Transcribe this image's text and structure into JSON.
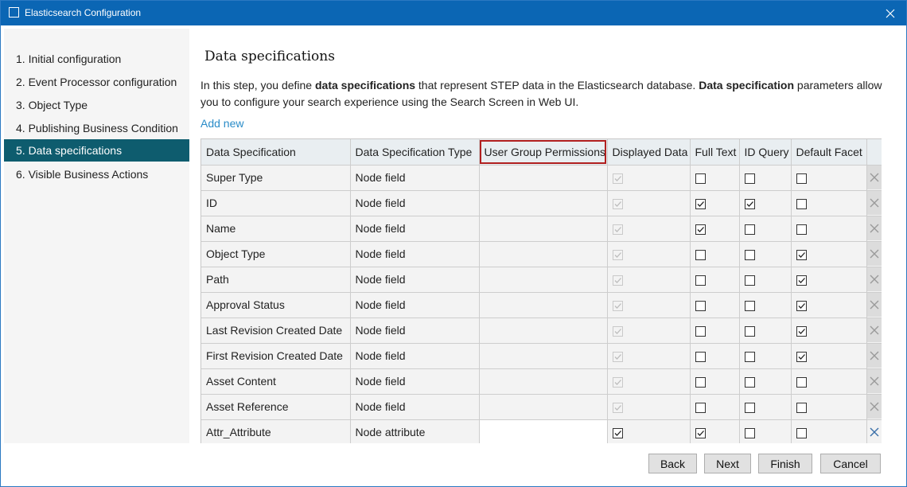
{
  "window": {
    "title": "Elasticsearch Configuration"
  },
  "steps": [
    {
      "label": "1. Initial configuration"
    },
    {
      "label": "2. Event Processor configuration"
    },
    {
      "label": "3. Object Type"
    },
    {
      "label": "4. Publishing Business Condition"
    },
    {
      "label": "5. Data specifications",
      "active": true
    },
    {
      "label": "6. Visible Business Actions"
    }
  ],
  "content": {
    "heading": "Data specifications",
    "desc": {
      "p1": "In this step, you define ",
      "b1": "data specifications",
      "p2": " that represent STEP data in the Elasticsearch database. ",
      "b2": "Data specification",
      "p3": " parameters allow you to configure your search experience using the Search Screen in Web UI."
    },
    "add_new": "Add new"
  },
  "table": {
    "columns": [
      "Data Specification",
      "Data Specification Type",
      "User Group Permissions",
      "Displayed Data",
      "Full Text",
      "ID Query",
      "Default Facet"
    ],
    "highlighted_column": "User Group Permissions",
    "rows": [
      {
        "spec": "Super Type",
        "type": "Node field",
        "perm": "",
        "displayed": true,
        "displayed_enabled": false,
        "full_text": false,
        "id_query": false,
        "facet": false
      },
      {
        "spec": "ID",
        "type": "Node field",
        "perm": "",
        "displayed": true,
        "displayed_enabled": false,
        "full_text": true,
        "id_query": true,
        "facet": false
      },
      {
        "spec": "Name",
        "type": "Node field",
        "perm": "",
        "displayed": true,
        "displayed_enabled": false,
        "full_text": true,
        "id_query": false,
        "facet": false
      },
      {
        "spec": "Object Type",
        "type": "Node field",
        "perm": "",
        "displayed": true,
        "displayed_enabled": false,
        "full_text": false,
        "id_query": false,
        "facet": true
      },
      {
        "spec": "Path",
        "type": "Node field",
        "perm": "",
        "displayed": true,
        "displayed_enabled": false,
        "full_text": false,
        "id_query": false,
        "facet": true
      },
      {
        "spec": "Approval Status",
        "type": "Node field",
        "perm": "",
        "displayed": true,
        "displayed_enabled": false,
        "full_text": false,
        "id_query": false,
        "facet": true
      },
      {
        "spec": "Last Revision Created Date",
        "type": "Node field",
        "perm": "",
        "displayed": true,
        "displayed_enabled": false,
        "full_text": false,
        "id_query": false,
        "facet": true
      },
      {
        "spec": "First Revision Created Date",
        "type": "Node field",
        "perm": "",
        "displayed": true,
        "displayed_enabled": false,
        "full_text": false,
        "id_query": false,
        "facet": true
      },
      {
        "spec": "Asset Content",
        "type": "Node field",
        "perm": "",
        "displayed": true,
        "displayed_enabled": false,
        "full_text": false,
        "id_query": false,
        "facet": false
      },
      {
        "spec": "Asset Reference",
        "type": "Node field",
        "perm": "",
        "displayed": true,
        "displayed_enabled": false,
        "full_text": false,
        "id_query": false,
        "facet": false
      },
      {
        "spec": "Attr_Attribute",
        "type": "Node attribute",
        "perm": "",
        "displayed": true,
        "displayed_enabled": true,
        "full_text": true,
        "id_query": false,
        "facet": false,
        "editing": true
      }
    ]
  },
  "buttons": {
    "back": "Back",
    "next": "Next",
    "finish": "Finish",
    "cancel": "Cancel"
  },
  "colors": {
    "titlebar": "#0b66b4",
    "active_step": "#0e5c6e",
    "link": "#2a8cc8",
    "highlight_border": "#b11f1f"
  }
}
